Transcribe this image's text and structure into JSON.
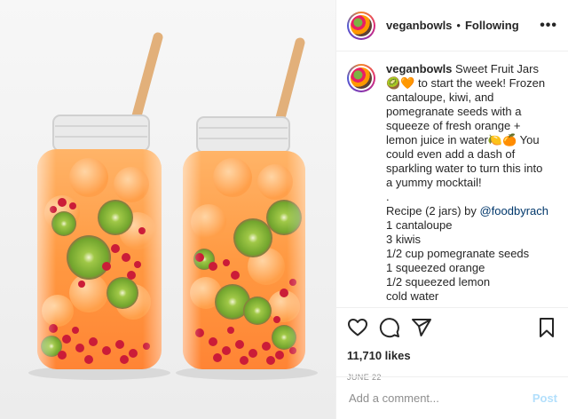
{
  "header": {
    "username": "veganbowls",
    "separator": "•",
    "follow_status": "Following",
    "more": "•••"
  },
  "caption": {
    "username": "veganbowls",
    "part1": "Sweet Fruit Jars🥝🧡 to start the week! Frozen cantaloupe, kiwi, and pomegranate seeds with a squeeze of fresh orange + lemon juice in water🍋🍊 You could even add a dash of sparkling water to turn this into a yummy mocktail!\n.\nRecipe (2 jars) by ",
    "mention": "@foodbyrach",
    "part2": "\n1 cantaloupe\n3 kiwis\n1/2 cup pomegranate seeds\n1 squeezed orange\n1/2 squeezed lemon\ncold water\n.\nHave a wonderful week Coco Community! Sip your next jar of fresh fruit goodness with naturally perfect"
  },
  "likes": "11,710 likes",
  "date": "JUNE 22",
  "comment": {
    "placeholder": "Add a comment...",
    "post_label": "Post"
  },
  "icons": [
    "heart-icon",
    "comment-icon",
    "share-icon",
    "bookmark-icon"
  ],
  "colors": {
    "link": "#00376b",
    "post_disabled": "#b2dffc",
    "muted": "#8e8e8e"
  }
}
